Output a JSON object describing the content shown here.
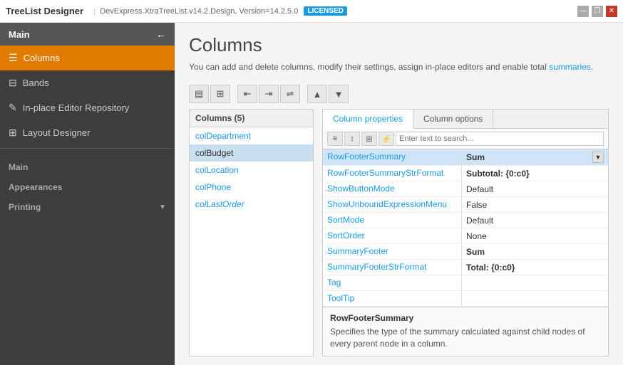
{
  "titleBar": {
    "logo": "TreeList Designer",
    "separator": "|",
    "info": "DevExpress.XtraTreeList.v14.2.Design, Version=14.2.5.0",
    "badge": "LICENSED",
    "minimizeBtn": "🗕",
    "restoreBtn": "❐",
    "closeBtn": "✕"
  },
  "sidebar": {
    "mainHeader": "Main",
    "backArrow": "←",
    "items": [
      {
        "id": "columns",
        "label": "Columns",
        "icon": "☰",
        "active": true
      },
      {
        "id": "bands",
        "label": "Bands",
        "icon": "⊟"
      },
      {
        "id": "editor-repo",
        "label": "In-place Editor Repository",
        "icon": "✎"
      },
      {
        "id": "layout",
        "label": "Layout Designer",
        "icon": "⊞"
      }
    ],
    "groups": [
      {
        "id": "main",
        "label": "Main"
      },
      {
        "id": "appearances",
        "label": "Appearances"
      },
      {
        "id": "printing",
        "label": "Printing"
      }
    ],
    "expandIcon": "▼"
  },
  "content": {
    "title": "Columns",
    "description": "You can add and delete columns, modify their settings, assign in-place editors and enable total summaries.",
    "descriptionLinkText": "summaries"
  },
  "toolbar": {
    "buttons": [
      "▤",
      "⊞",
      "⇤",
      "⇥",
      "⇌",
      "▲",
      "▼"
    ]
  },
  "columnList": {
    "header": "Columns (5)",
    "items": [
      {
        "id": "colDepartment",
        "label": "colDepartment",
        "selected": false,
        "italic": false
      },
      {
        "id": "colBudget",
        "label": "colBudget",
        "selected": true,
        "italic": false
      },
      {
        "id": "colLocation",
        "label": "colLocation",
        "selected": false,
        "italic": false
      },
      {
        "id": "colPhone",
        "label": "colPhone",
        "selected": false,
        "italic": false
      },
      {
        "id": "colLastOrder",
        "label": "colLastOrder",
        "selected": false,
        "italic": true
      }
    ]
  },
  "propertiesPanel": {
    "tabs": [
      {
        "id": "properties",
        "label": "Column properties",
        "active": true
      },
      {
        "id": "options",
        "label": "Column options",
        "active": false
      }
    ],
    "toolbarButtons": [
      "≡",
      "↕",
      "⊞",
      "⚡"
    ],
    "searchPlaceholder": "Enter text to search...",
    "properties": [
      {
        "name": "RowFooterSummary",
        "value": "Sum",
        "selected": true,
        "hasDropdown": true,
        "bold": true
      },
      {
        "name": "RowFooterSummaryStrFormat",
        "value": "Subtotal: {0:c0}",
        "selected": false,
        "bold": true
      },
      {
        "name": "ShowButtonMode",
        "value": "Default",
        "selected": false
      },
      {
        "name": "ShowUnboundExpressionMenu",
        "value": "False",
        "selected": false
      },
      {
        "name": "SortMode",
        "value": "Default",
        "selected": false
      },
      {
        "name": "SortOrder",
        "value": "None",
        "selected": false
      },
      {
        "name": "SummaryFooter",
        "value": "Sum",
        "selected": false,
        "bold": true
      },
      {
        "name": "SummaryFooterStrFormat",
        "value": "Total: {0:c0}",
        "selected": false,
        "bold": true
      },
      {
        "name": "Tag",
        "value": "",
        "selected": false
      },
      {
        "name": "ToolTip",
        "value": "",
        "selected": false
      }
    ],
    "description": {
      "title": "RowFooterSummary",
      "text": "Specifies the type of the summary calculated against child nodes of every parent node in a column."
    }
  }
}
